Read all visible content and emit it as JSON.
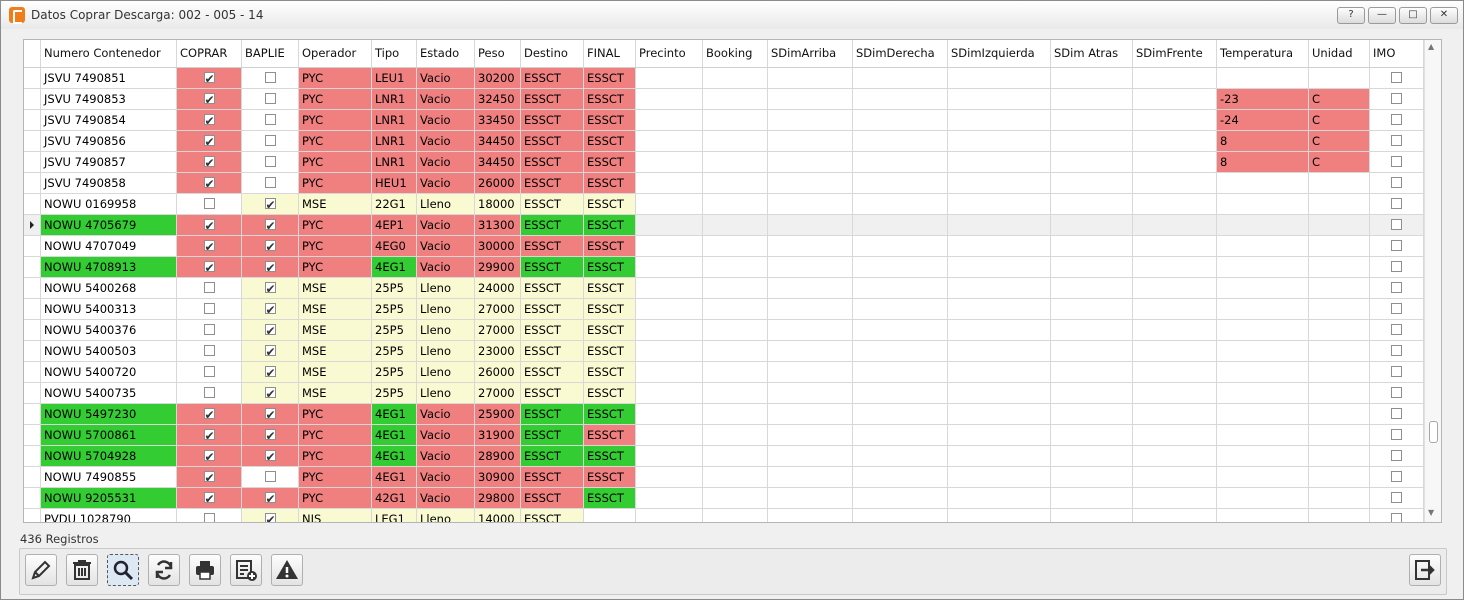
{
  "window": {
    "title": "Datos Coprar Descarga: 002 - 005 - 14",
    "buttons": [
      "?",
      "—",
      "□",
      "✕"
    ]
  },
  "columns": [
    "Numero Contenedor",
    "COPRAR",
    "BAPLIE",
    "Operador",
    "Tipo",
    "Estado",
    "Peso",
    "Destino",
    "FINAL",
    "Precinto",
    "Booking",
    "SDimArriba",
    "SDimDerecha",
    "SDimIzquierda",
    "SDim Atras",
    "SDimFrente",
    "Temperatura",
    "Unidad",
    "IMO"
  ],
  "rows": [
    {
      "cont": "JSVU 7490851",
      "coprar": true,
      "baplie": false,
      "op": "PYC",
      "tipo": "LEU1",
      "estado": "Vacio",
      "peso": "30200",
      "dest": "ESSCT",
      "final": "ESSCT",
      "temp": "",
      "unidad": "",
      "imo": false,
      "hl": {
        "coprar": "red",
        "op": "red",
        "tipo": "red",
        "estado": "red",
        "peso": "red",
        "dest": "red",
        "final": "red"
      }
    },
    {
      "cont": "JSVU 7490853",
      "coprar": true,
      "baplie": false,
      "op": "PYC",
      "tipo": "LNR1",
      "estado": "Vacio",
      "peso": "32450",
      "dest": "ESSCT",
      "final": "ESSCT",
      "temp": "-23",
      "unidad": "C",
      "imo": false,
      "hl": {
        "coprar": "red",
        "op": "red",
        "tipo": "red",
        "estado": "red",
        "peso": "red",
        "dest": "red",
        "final": "red",
        "temp": "red",
        "unidad": "red"
      }
    },
    {
      "cont": "JSVU 7490854",
      "coprar": true,
      "baplie": false,
      "op": "PYC",
      "tipo": "LNR1",
      "estado": "Vacio",
      "peso": "33450",
      "dest": "ESSCT",
      "final": "ESSCT",
      "temp": "-24",
      "unidad": "C",
      "imo": false,
      "hl": {
        "coprar": "red",
        "op": "red",
        "tipo": "red",
        "estado": "red",
        "peso": "red",
        "dest": "red",
        "final": "red",
        "temp": "red",
        "unidad": "red"
      }
    },
    {
      "cont": "JSVU 7490856",
      "coprar": true,
      "baplie": false,
      "op": "PYC",
      "tipo": "LNR1",
      "estado": "Vacio",
      "peso": "34450",
      "dest": "ESSCT",
      "final": "ESSCT",
      "temp": "8",
      "unidad": "C",
      "imo": false,
      "hl": {
        "coprar": "red",
        "op": "red",
        "tipo": "red",
        "estado": "red",
        "peso": "red",
        "dest": "red",
        "final": "red",
        "temp": "red",
        "unidad": "red"
      }
    },
    {
      "cont": "JSVU 7490857",
      "coprar": true,
      "baplie": false,
      "op": "PYC",
      "tipo": "LNR1",
      "estado": "Vacio",
      "peso": "34450",
      "dest": "ESSCT",
      "final": "ESSCT",
      "temp": "8",
      "unidad": "C",
      "imo": false,
      "hl": {
        "coprar": "red",
        "op": "red",
        "tipo": "red",
        "estado": "red",
        "peso": "red",
        "dest": "red",
        "final": "red",
        "temp": "red",
        "unidad": "red"
      }
    },
    {
      "cont": "JSVU 7490858",
      "coprar": true,
      "baplie": false,
      "op": "PYC",
      "tipo": "HEU1",
      "estado": "Vacio",
      "peso": "26000",
      "dest": "ESSCT",
      "final": "ESSCT",
      "temp": "",
      "unidad": "",
      "imo": false,
      "hl": {
        "coprar": "red",
        "op": "red",
        "tipo": "red",
        "estado": "red",
        "peso": "red",
        "dest": "red",
        "final": "red"
      }
    },
    {
      "cont": "NOWU 0169958",
      "coprar": false,
      "baplie": true,
      "op": "MSE",
      "tipo": "22G1",
      "estado": "Lleno",
      "peso": "18000",
      "dest": "ESSCT",
      "final": "ESSCT",
      "temp": "",
      "unidad": "",
      "imo": false,
      "hl": {
        "baplie": "yellow",
        "op": "yellow",
        "tipo": "yellow",
        "estado": "yellow",
        "peso": "yellow",
        "dest": "yellow",
        "final": "yellow"
      }
    },
    {
      "cont": "NOWU 4705679",
      "coprar": true,
      "baplie": true,
      "op": "PYC",
      "tipo": "4EP1",
      "estado": "Vacio",
      "peso": "31300",
      "dest": "ESSCT",
      "final": "ESSCT",
      "temp": "",
      "unidad": "",
      "imo": false,
      "sel": true,
      "hl": {
        "cont": "green",
        "coprar": "red",
        "baplie": "red",
        "op": "red",
        "tipo": "red",
        "estado": "red",
        "peso": "red",
        "dest": "green",
        "final": "green"
      }
    },
    {
      "cont": "NOWU 4707049",
      "coprar": true,
      "baplie": true,
      "op": "PYC",
      "tipo": "4EG0",
      "estado": "Vacio",
      "peso": "30000",
      "dest": "ESSCT",
      "final": "ESSCT",
      "temp": "",
      "unidad": "",
      "imo": false,
      "hl": {
        "coprar": "red",
        "baplie": "red",
        "op": "red",
        "tipo": "red",
        "estado": "red",
        "peso": "red",
        "dest": "red",
        "final": "red"
      }
    },
    {
      "cont": "NOWU 4708913",
      "coprar": true,
      "baplie": true,
      "op": "PYC",
      "tipo": "4EG1",
      "estado": "Vacio",
      "peso": "29900",
      "dest": "ESSCT",
      "final": "ESSCT",
      "temp": "",
      "unidad": "",
      "imo": false,
      "hl": {
        "cont": "green",
        "coprar": "red",
        "baplie": "red",
        "op": "red",
        "tipo": "green",
        "estado": "red",
        "peso": "red",
        "dest": "green",
        "final": "green"
      }
    },
    {
      "cont": "NOWU 5400268",
      "coprar": false,
      "baplie": true,
      "op": "MSE",
      "tipo": "25P5",
      "estado": "Lleno",
      "peso": "24000",
      "dest": "ESSCT",
      "final": "ESSCT",
      "temp": "",
      "unidad": "",
      "imo": false,
      "hl": {
        "baplie": "yellow",
        "op": "yellow",
        "tipo": "yellow",
        "estado": "yellow",
        "peso": "yellow",
        "dest": "yellow",
        "final": "yellow"
      }
    },
    {
      "cont": "NOWU 5400313",
      "coprar": false,
      "baplie": true,
      "op": "MSE",
      "tipo": "25P5",
      "estado": "Lleno",
      "peso": "27000",
      "dest": "ESSCT",
      "final": "ESSCT",
      "temp": "",
      "unidad": "",
      "imo": false,
      "hl": {
        "baplie": "yellow",
        "op": "yellow",
        "tipo": "yellow",
        "estado": "yellow",
        "peso": "yellow",
        "dest": "yellow",
        "final": "yellow"
      }
    },
    {
      "cont": "NOWU 5400376",
      "coprar": false,
      "baplie": true,
      "op": "MSE",
      "tipo": "25P5",
      "estado": "Lleno",
      "peso": "27000",
      "dest": "ESSCT",
      "final": "ESSCT",
      "temp": "",
      "unidad": "",
      "imo": false,
      "hl": {
        "baplie": "yellow",
        "op": "yellow",
        "tipo": "yellow",
        "estado": "yellow",
        "peso": "yellow",
        "dest": "yellow",
        "final": "yellow"
      }
    },
    {
      "cont": "NOWU 5400503",
      "coprar": false,
      "baplie": true,
      "op": "MSE",
      "tipo": "25P5",
      "estado": "Lleno",
      "peso": "23000",
      "dest": "ESSCT",
      "final": "ESSCT",
      "temp": "",
      "unidad": "",
      "imo": false,
      "hl": {
        "baplie": "yellow",
        "op": "yellow",
        "tipo": "yellow",
        "estado": "yellow",
        "peso": "yellow",
        "dest": "yellow",
        "final": "yellow"
      }
    },
    {
      "cont": "NOWU 5400720",
      "coprar": false,
      "baplie": true,
      "op": "MSE",
      "tipo": "25P5",
      "estado": "Lleno",
      "peso": "26000",
      "dest": "ESSCT",
      "final": "ESSCT",
      "temp": "",
      "unidad": "",
      "imo": false,
      "hl": {
        "baplie": "yellow",
        "op": "yellow",
        "tipo": "yellow",
        "estado": "yellow",
        "peso": "yellow",
        "dest": "yellow",
        "final": "yellow"
      }
    },
    {
      "cont": "NOWU 5400735",
      "coprar": false,
      "baplie": true,
      "op": "MSE",
      "tipo": "25P5",
      "estado": "Lleno",
      "peso": "27000",
      "dest": "ESSCT",
      "final": "ESSCT",
      "temp": "",
      "unidad": "",
      "imo": false,
      "hl": {
        "baplie": "yellow",
        "op": "yellow",
        "tipo": "yellow",
        "estado": "yellow",
        "peso": "yellow",
        "dest": "yellow",
        "final": "yellow"
      }
    },
    {
      "cont": "NOWU 5497230",
      "coprar": true,
      "baplie": true,
      "op": "PYC",
      "tipo": "4EG1",
      "estado": "Vacio",
      "peso": "25900",
      "dest": "ESSCT",
      "final": "ESSCT",
      "temp": "",
      "unidad": "",
      "imo": false,
      "hl": {
        "cont": "green",
        "coprar": "red",
        "baplie": "red",
        "op": "red",
        "tipo": "green",
        "estado": "red",
        "peso": "red",
        "dest": "green",
        "final": "green"
      }
    },
    {
      "cont": "NOWU 5700861",
      "coprar": true,
      "baplie": true,
      "op": "PYC",
      "tipo": "4EG1",
      "estado": "Vacio",
      "peso": "31900",
      "dest": "ESSCT",
      "final": "ESSCT",
      "temp": "",
      "unidad": "",
      "imo": false,
      "hl": {
        "cont": "green",
        "coprar": "red",
        "baplie": "red",
        "op": "red",
        "tipo": "green",
        "estado": "red",
        "peso": "red",
        "dest": "green",
        "final": "red"
      }
    },
    {
      "cont": "NOWU 5704928",
      "coprar": true,
      "baplie": true,
      "op": "PYC",
      "tipo": "4EG1",
      "estado": "Vacio",
      "peso": "28900",
      "dest": "ESSCT",
      "final": "ESSCT",
      "temp": "",
      "unidad": "",
      "imo": false,
      "hl": {
        "cont": "green",
        "coprar": "red",
        "baplie": "red",
        "op": "red",
        "tipo": "green",
        "estado": "red",
        "peso": "red",
        "dest": "green",
        "final": "green"
      }
    },
    {
      "cont": "NOWU 7490855",
      "coprar": true,
      "baplie": false,
      "op": "PYC",
      "tipo": "4EG1",
      "estado": "Vacio",
      "peso": "30900",
      "dest": "ESSCT",
      "final": "ESSCT",
      "temp": "",
      "unidad": "",
      "imo": false,
      "hl": {
        "coprar": "red",
        "op": "red",
        "tipo": "red",
        "estado": "red",
        "peso": "red",
        "dest": "red",
        "final": "red"
      }
    },
    {
      "cont": "NOWU 9205531",
      "coprar": true,
      "baplie": true,
      "op": "PYC",
      "tipo": "42G1",
      "estado": "Vacio",
      "peso": "29800",
      "dest": "ESSCT",
      "final": "ESSCT",
      "temp": "",
      "unidad": "",
      "imo": false,
      "hl": {
        "cont": "green",
        "coprar": "red",
        "baplie": "red",
        "op": "red",
        "tipo": "red",
        "estado": "red",
        "peso": "red",
        "dest": "red",
        "final": "green"
      }
    },
    {
      "cont": "PVDU 1028790",
      "coprar": false,
      "baplie": true,
      "op": "NIS",
      "tipo": "LEG1",
      "estado": "Lleno",
      "peso": "14000",
      "dest": "ESSCT",
      "final": "",
      "temp": "",
      "unidad": "",
      "imo": false,
      "hl": {
        "baplie": "yellow",
        "op": "yellow",
        "tipo": "yellow",
        "estado": "yellow",
        "peso": "yellow",
        "dest": "yellow"
      }
    }
  ],
  "status": {
    "records": "436 Registros"
  },
  "toolbar": [
    {
      "name": "edit-button",
      "icon": "pencil-icon"
    },
    {
      "name": "delete-button",
      "icon": "trash-icon"
    },
    {
      "name": "search-button",
      "icon": "magnifier-icon"
    },
    {
      "name": "refresh-button",
      "icon": "refresh-icon"
    },
    {
      "name": "print-button",
      "icon": "printer-icon"
    },
    {
      "name": "add-list-button",
      "icon": "list-add-icon"
    },
    {
      "name": "warning-button",
      "icon": "warning-icon"
    }
  ],
  "exit_button": {
    "name": "exit-button",
    "icon": "exit-icon"
  },
  "colors": {
    "red": "#f08080",
    "green": "#33cc33",
    "yellow": "#fafad2"
  }
}
